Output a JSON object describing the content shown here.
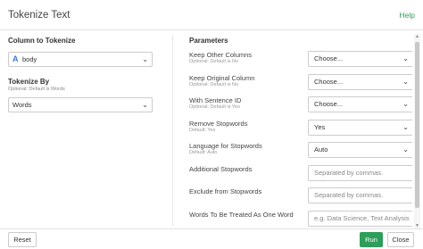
{
  "header": {
    "title": "Tokenize Text",
    "help_label": "Help"
  },
  "left": {
    "column_section_title": "Column to Tokenize",
    "column_select_value": "body",
    "tokenize_by_title": "Tokenize By",
    "tokenize_by_sub": "Optional: Default is Words",
    "tokenize_by_value": "Words"
  },
  "params": {
    "title": "Parameters",
    "rows": [
      {
        "label": "Keep Other Columns",
        "sub": "Optional: Default is No",
        "kind": "select",
        "value": "Choose..."
      },
      {
        "label": "Keep Original Column",
        "sub": "Optional: Default is No",
        "kind": "select",
        "value": "Choose..."
      },
      {
        "label": "With Sentence ID",
        "sub": "Optional: Default is Yes",
        "kind": "select",
        "value": "Choose..."
      },
      {
        "label": "Remove Stopwords",
        "sub": "Default: Yes",
        "kind": "select",
        "value": "Yes"
      },
      {
        "label": "Language for Stopwords",
        "sub": "Default: Auto",
        "kind": "select",
        "value": "Auto"
      },
      {
        "label": "Additional Stopwords",
        "sub": "",
        "kind": "input",
        "placeholder": "Separated by commas."
      },
      {
        "label": "Exclude from Stopwords",
        "sub": "",
        "kind": "input",
        "placeholder": "Separated by commas."
      },
      {
        "label": "Words To Be Treated As One Word",
        "sub": "",
        "kind": "input",
        "placeholder": "e.g. Data Science, Text Analysis"
      }
    ]
  },
  "footer": {
    "reset_label": "Reset",
    "run_label": "Run",
    "close_label": "Close"
  },
  "colors": {
    "accent": "#2e9e5b",
    "column_icon": "#3b78d8"
  },
  "icons": {
    "column_type": "letter-a-icon",
    "dropdown": "chevron-down-icon"
  }
}
